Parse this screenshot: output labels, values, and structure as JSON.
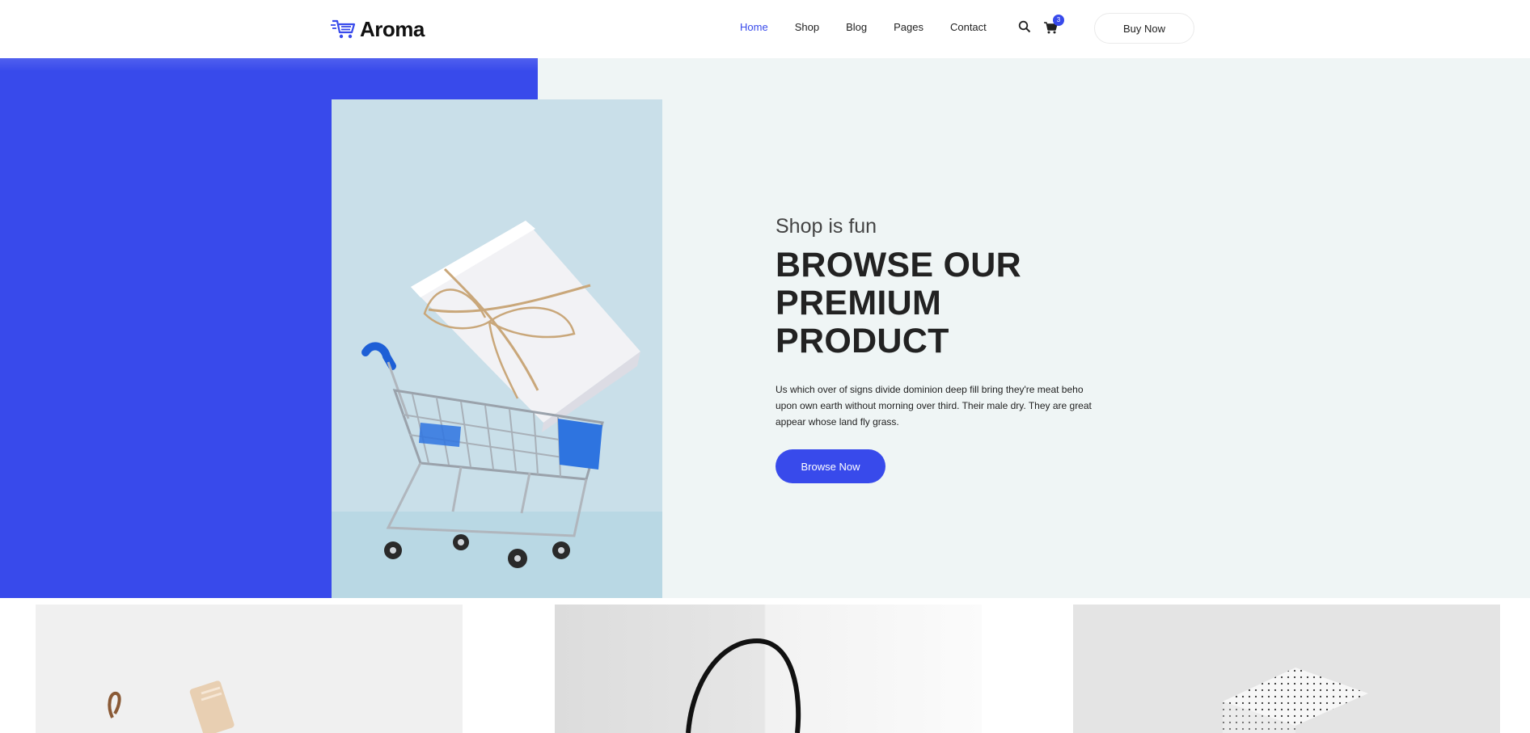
{
  "brand": {
    "name": "Aroma",
    "accent": "#384aeb"
  },
  "nav": {
    "items": [
      {
        "label": "Home",
        "active": true
      },
      {
        "label": "Shop",
        "active": false
      },
      {
        "label": "Blog",
        "active": false
      },
      {
        "label": "Pages",
        "active": false
      },
      {
        "label": "Contact",
        "active": false
      }
    ]
  },
  "header": {
    "search_icon": "search-icon",
    "cart_icon": "cart-icon",
    "cart_count": "3",
    "buy_label": "Buy Now"
  },
  "hero": {
    "subtitle": "Shop is fun",
    "title": "BROWSE OUR PREMIUM PRODUCT",
    "title_lines": [
      "BROWSE OUR",
      "PREMIUM",
      "PRODUCT"
    ],
    "description": "Us which over of signs divide dominion deep fill bring they're meat beho upon own earth without morning over third. Their male dry. They are great appear whose land fly grass.",
    "button_label": "Browse Now",
    "image": "shopping-cart-with-gift-box"
  },
  "products": [
    {
      "image": "kraft-gift-box"
    },
    {
      "image": "black-bag-handle"
    },
    {
      "image": "dotted-gift-box"
    }
  ]
}
